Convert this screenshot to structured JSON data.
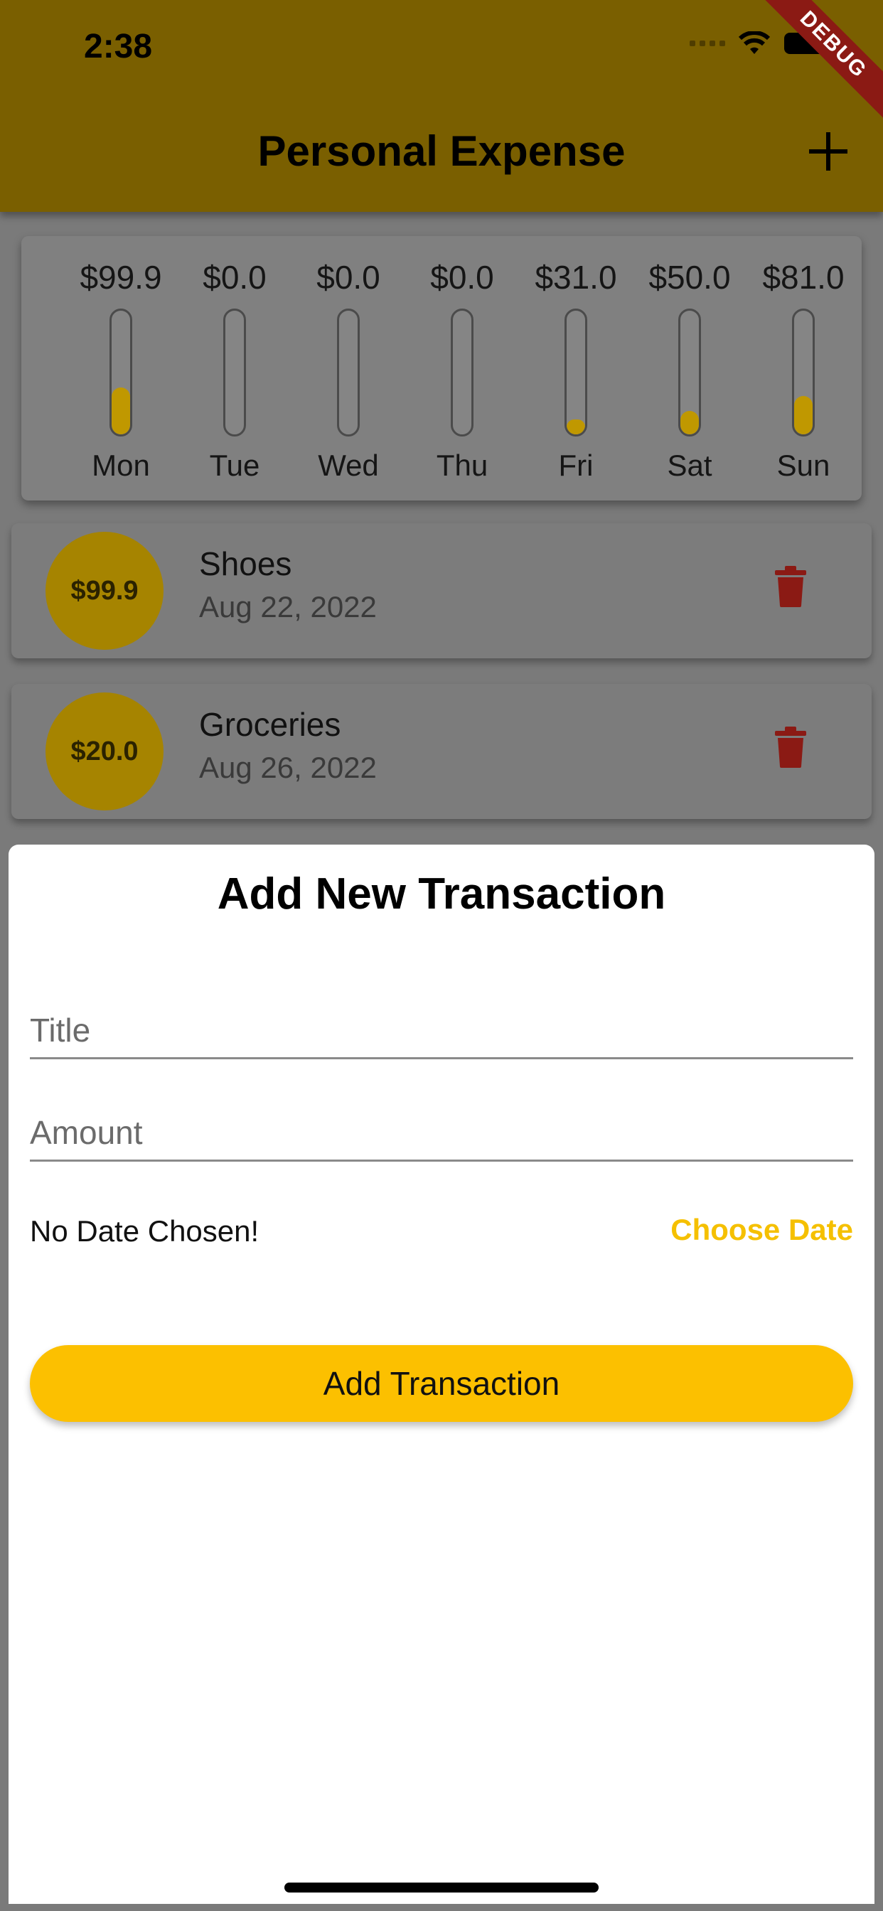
{
  "status_bar": {
    "time": "2:38",
    "debug_label": "DEBUG"
  },
  "app_bar": {
    "title": "Personal Expense"
  },
  "chart": {
    "days": [
      {
        "day": "Mon",
        "amount": "$99.9",
        "fill": 0.38
      },
      {
        "day": "Tue",
        "amount": "$0.0",
        "fill": 0.0
      },
      {
        "day": "Wed",
        "amount": "$0.0",
        "fill": 0.0
      },
      {
        "day": "Thu",
        "amount": "$0.0",
        "fill": 0.0
      },
      {
        "day": "Fri",
        "amount": "$31.0",
        "fill": 0.12
      },
      {
        "day": "Sat",
        "amount": "$50.0",
        "fill": 0.19
      },
      {
        "day": "Sun",
        "amount": "$81.0",
        "fill": 0.31
      }
    ]
  },
  "transactions": [
    {
      "amount": "$99.9",
      "title": "Shoes",
      "date": "Aug 22, 2022"
    },
    {
      "amount": "$20.0",
      "title": "Groceries",
      "date": "Aug 26, 2022"
    }
  ],
  "sheet": {
    "title": "Add New Transaction",
    "title_placeholder": "Title",
    "amount_placeholder": "Amount",
    "date_text": "No Date Chosen!",
    "choose_date_label": "Choose Date",
    "submit_label": "Add Transaction"
  },
  "colors": {
    "accent": "#fcc000",
    "delete": "#8b1a14"
  }
}
